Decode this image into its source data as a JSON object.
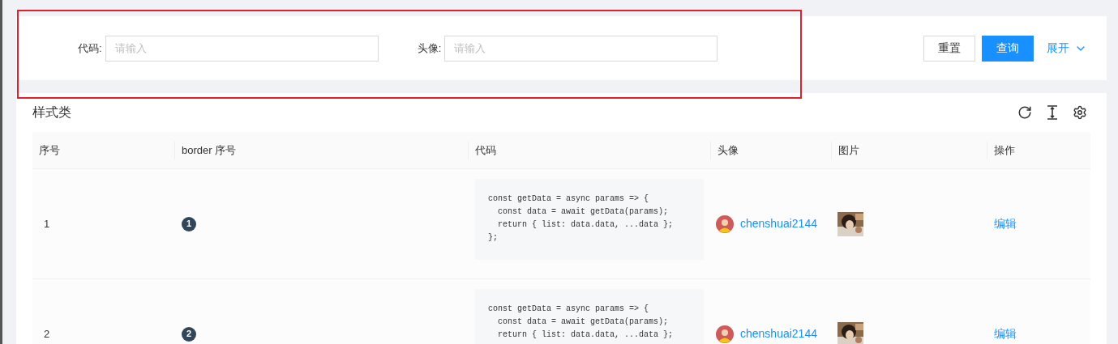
{
  "search_form": {
    "fields": [
      {
        "label": "代码:",
        "placeholder": "请输入"
      },
      {
        "label": "头像:",
        "placeholder": "请输入"
      }
    ],
    "buttons": [
      {
        "label": "重置",
        "kind": "default"
      },
      {
        "label": "查询",
        "kind": "primary"
      }
    ],
    "expand_link": "展开"
  },
  "table": {
    "title": "样式类",
    "columns": [
      "序号",
      "border 序号",
      "代码",
      "头像",
      "图片",
      "操作"
    ],
    "rows": [
      {
        "index": "1",
        "badge": "1",
        "code": [
          "const getData = async params => {",
          "  const data = await getData(params);",
          "  return { list: data.data, ...data };",
          "};"
        ],
        "user": "chenshuai2144",
        "action": "编辑"
      },
      {
        "index": "2",
        "badge": "2",
        "code": [
          "const getData = async params => {",
          "  const data = await getData(params);",
          "  return { list: data.data, ...data };"
        ],
        "user": "chenshuai2144",
        "action": "编辑"
      }
    ]
  }
}
